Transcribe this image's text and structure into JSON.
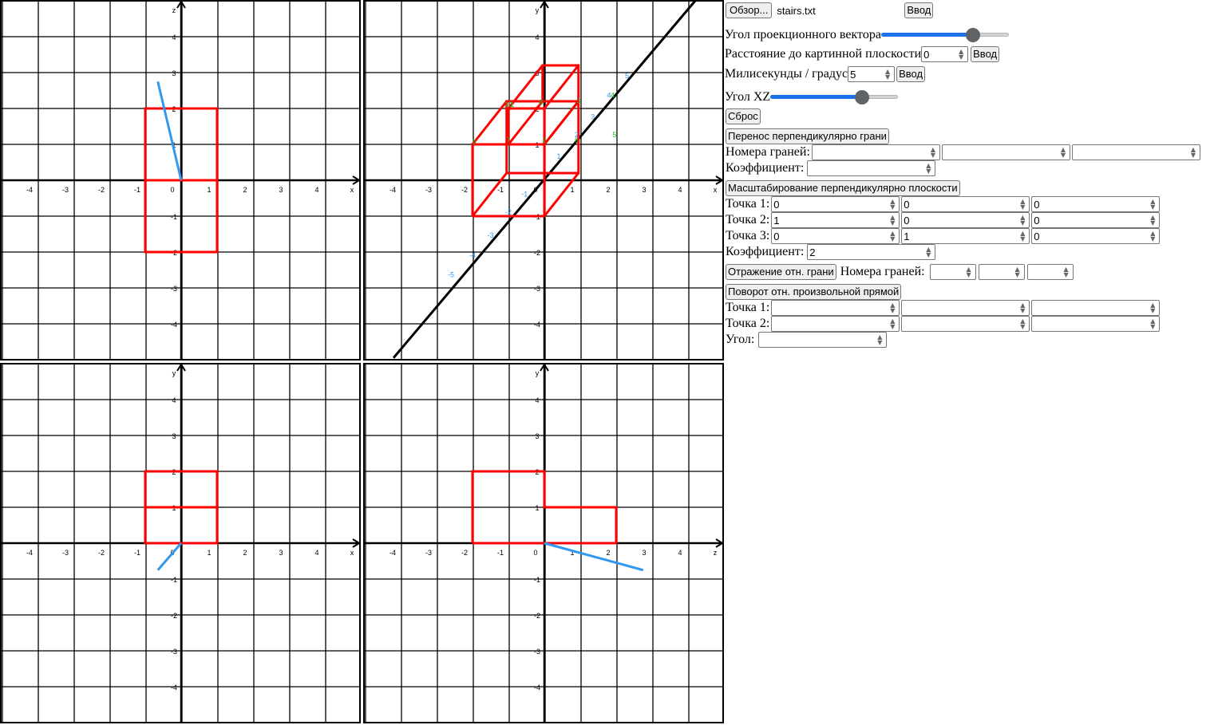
{
  "views": [
    {
      "id": "view-front",
      "h_axis": "x",
      "v_axis": "z",
      "ticks": [
        -4,
        -3,
        -2,
        -1,
        1,
        2,
        3,
        4
      ]
    },
    {
      "id": "view-projection",
      "h_axis": "x",
      "v_axis": "y",
      "ticks": [
        -4,
        -3,
        -2,
        -1,
        1,
        2,
        3,
        4
      ]
    },
    {
      "id": "view-top",
      "h_axis": "x",
      "v_axis": "y",
      "ticks": [
        -4,
        -3,
        -2,
        -1,
        1,
        2,
        3,
        4
      ]
    },
    {
      "id": "view-side",
      "h_axis": "z",
      "v_axis": "y",
      "ticks": [
        -4,
        -3,
        -2,
        -1,
        1,
        2,
        3,
        4
      ]
    }
  ],
  "origin_label": "0",
  "projection_axis_labels": [
    "-5",
    "-4",
    "-3",
    "-2",
    "-1",
    "1",
    "2",
    "3",
    "4",
    "5"
  ],
  "vertex_labels": [
    "1",
    "2",
    "3",
    "4",
    "5",
    "6",
    "7",
    "8",
    "9",
    "10"
  ],
  "colors": {
    "grid": "#000000",
    "figure": "#ff0000",
    "vector": "#3399ee",
    "vertex_label": "#22bb22",
    "axis_tick": "#3399ee",
    "accent": "#1a73e8"
  },
  "panel": {
    "browse_button": "Обзор...",
    "file_name": "stairs.txt",
    "load_enter_button": "Ввод",
    "projection_angle_label": "Угол проекционного вектора",
    "projection_angle_slider": 0.72,
    "distance_label": "Расстояние до картинной плоскости",
    "distance_value": "0",
    "distance_enter_button": "Ввод",
    "ms_label": "Милисекунды / градус",
    "ms_value": "5",
    "ms_enter_button": "Ввод",
    "xz_angle_label": "Угол XZ",
    "xz_angle_slider": 0.72,
    "reset_button": "Сброс",
    "translate": {
      "button": "Перенос перпендикулярно грани",
      "faces_label": "Номера граней:",
      "face_values": [
        "",
        "",
        ""
      ],
      "coef_label": "Коэффициент:",
      "coef_value": ""
    },
    "scale": {
      "button": "Масштабирование перпендикулярно плоскости",
      "point1_label": "Точка 1:",
      "point1": [
        "0",
        "0",
        "0"
      ],
      "point2_label": "Точка 2:",
      "point2": [
        "1",
        "0",
        "0"
      ],
      "point3_label": "Точка 3:",
      "point3": [
        "0",
        "1",
        "0"
      ],
      "coef_label": "Коэффициент:",
      "coef_value": "2"
    },
    "reflect": {
      "button": "Отражение отн. грани",
      "faces_label": "Номера граней:",
      "face_values": [
        "",
        "",
        ""
      ]
    },
    "rotate": {
      "button": "Поворот отн. произвольной прямой",
      "point1_label": "Точка 1:",
      "point1": [
        "",
        "",
        ""
      ],
      "point2_label": "Точка 2:",
      "point2": [
        "",
        "",
        ""
      ],
      "angle_label": "Угол:",
      "angle_value": ""
    }
  }
}
